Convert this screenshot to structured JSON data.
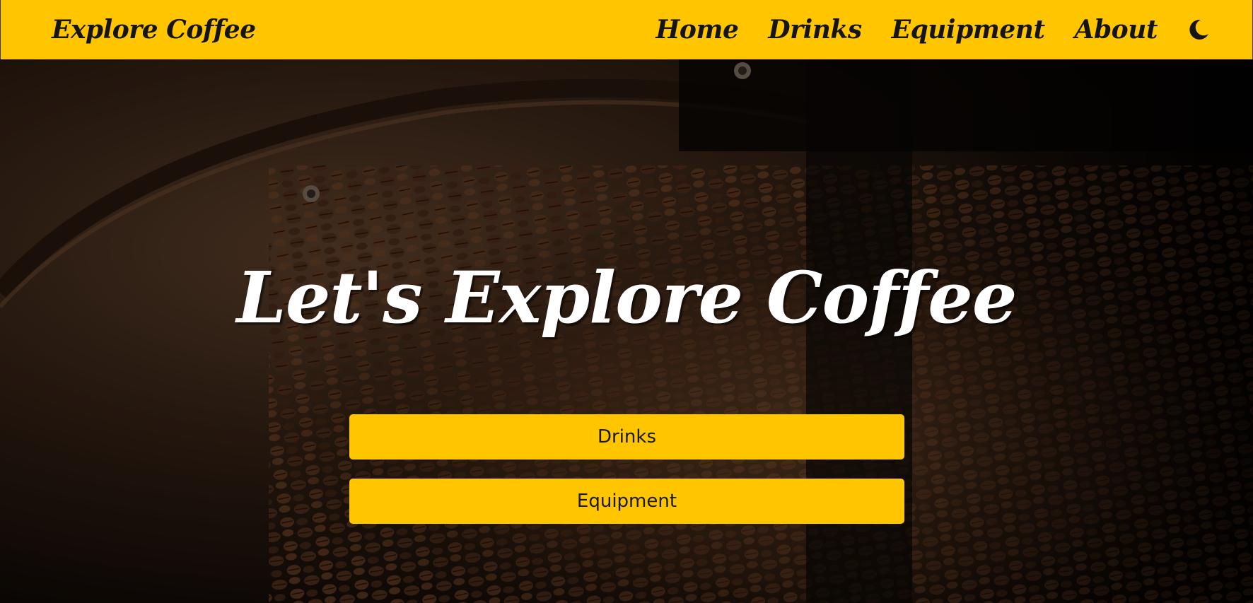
{
  "navbar": {
    "brand": "Explore Coffee",
    "links": [
      "Home",
      "Drinks",
      "Equipment",
      "About"
    ],
    "theme_icon": "moon-icon",
    "bg_color": "#ffc600"
  },
  "hero": {
    "title": "Let's Explore Coffee",
    "background": "coffee-beans-roaster-photo",
    "buttons": {
      "drinks": "Drinks",
      "equipment": "Equipment"
    },
    "button_color": "#ffc600"
  }
}
